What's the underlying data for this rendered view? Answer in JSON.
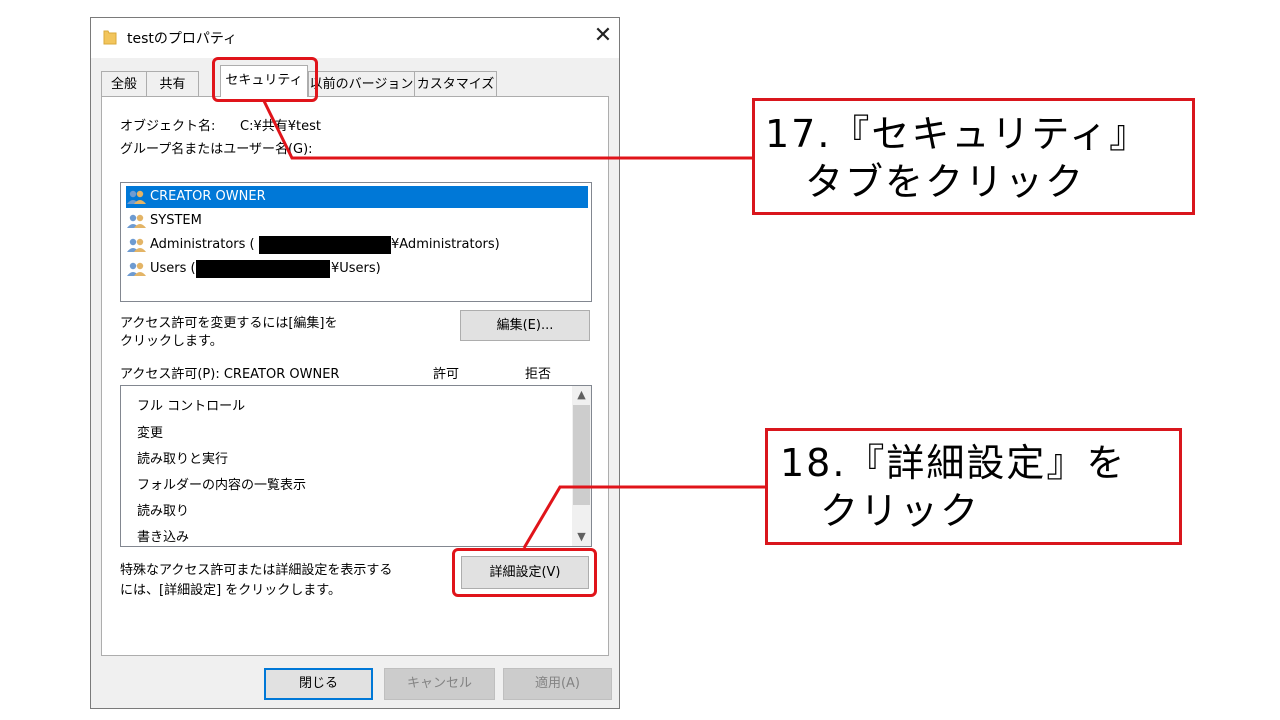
{
  "window": {
    "title": "testのプロパティ",
    "close_glyph": "✕"
  },
  "tabs": [
    {
      "label": "全般"
    },
    {
      "label": "共有"
    },
    {
      "label": "セキュリティ"
    },
    {
      "label": "以前のバージョン"
    },
    {
      "label": "カスタマイズ"
    }
  ],
  "active_tab": "セキュリティ",
  "security": {
    "object_name_label": "オブジェクト名:",
    "object_name_value": "C:¥共有¥test",
    "group_list_label": "グループ名またはユーザー名(G):",
    "principals": [
      {
        "name": "CREATOR OWNER",
        "selected": true
      },
      {
        "name": "SYSTEM",
        "selected": false
      },
      {
        "name": "Administrators (",
        "suffix": "¥Administrators)",
        "redacted": true
      },
      {
        "name": "Users (",
        "suffix": "¥Users)",
        "redacted": true
      }
    ],
    "edit_hint_line1": "アクセス許可を変更するには[編集]を",
    "edit_hint_line2": "クリックします。",
    "edit_button": "編集(E)...",
    "permissions_label": "アクセス許可(P): CREATOR OWNER",
    "allow_header": "許可",
    "deny_header": "拒否",
    "permissions": [
      "フル コントロール",
      "変更",
      "読み取りと実行",
      "フォルダーの内容の一覧表示",
      "読み取り",
      "書き込み"
    ],
    "advanced_hint_line1": "特殊なアクセス許可または詳細設定を表示する",
    "advanced_hint_line2": "には、[詳細設定] をクリックします。",
    "advanced_button": "詳細設定(V)"
  },
  "footer": {
    "close_button": "閉じる",
    "cancel_button": "キャンセル",
    "apply_button": "適用(A)"
  },
  "annotations": {
    "step17": "17.『セキュリティ』\n　タブをクリック",
    "step18": "18.『詳細設定』を\n　クリック",
    "color": "#e0141a"
  },
  "colors": {
    "selection": "#0078d7",
    "dialog_bg": "#f0f0f0"
  }
}
